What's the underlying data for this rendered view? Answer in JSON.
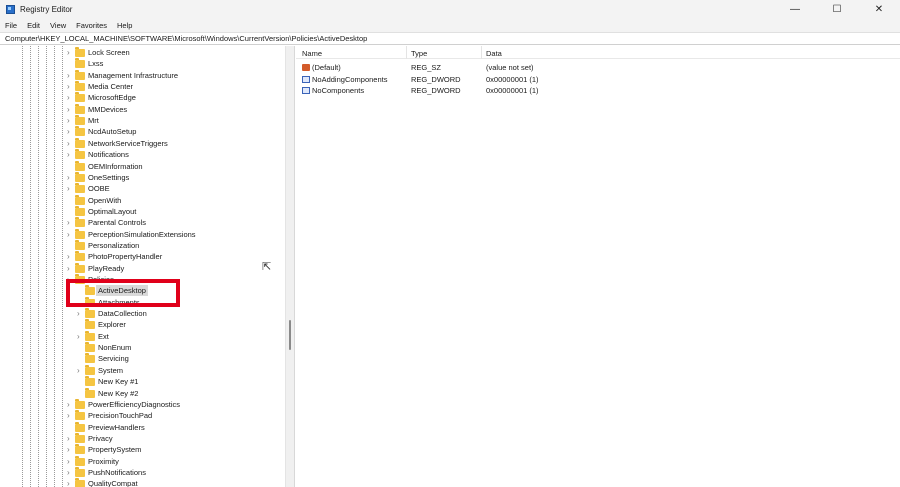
{
  "window": {
    "title": "Registry Editor",
    "minimize": "—",
    "maximize": "☐",
    "close": "✕"
  },
  "menu": [
    "File",
    "Edit",
    "View",
    "Favorites",
    "Help"
  ],
  "address": "Computer\\HKEY_LOCAL_MACHINE\\SOFTWARE\\Microsoft\\Windows\\CurrentVersion\\Policies\\ActiveDesktop",
  "tree": [
    {
      "label": "Lock Screen",
      "level": 0,
      "expander": true
    },
    {
      "label": "Lxss",
      "level": 0,
      "expander": false
    },
    {
      "label": "Management Infrastructure",
      "level": 0,
      "expander": true
    },
    {
      "label": "Media Center",
      "level": 0,
      "expander": true
    },
    {
      "label": "MicrosoftEdge",
      "level": 0,
      "expander": true
    },
    {
      "label": "MMDevices",
      "level": 0,
      "expander": true
    },
    {
      "label": "Mrt",
      "level": 0,
      "expander": true
    },
    {
      "label": "NcdAutoSetup",
      "level": 0,
      "expander": true
    },
    {
      "label": "NetworkServiceTriggers",
      "level": 0,
      "expander": true
    },
    {
      "label": "Notifications",
      "level": 0,
      "expander": true
    },
    {
      "label": "OEMInformation",
      "level": 0,
      "expander": false
    },
    {
      "label": "OneSettings",
      "level": 0,
      "expander": true
    },
    {
      "label": "OOBE",
      "level": 0,
      "expander": true
    },
    {
      "label": "OpenWith",
      "level": 0,
      "expander": false
    },
    {
      "label": "OptimalLayout",
      "level": 0,
      "expander": false
    },
    {
      "label": "Parental Controls",
      "level": 0,
      "expander": true
    },
    {
      "label": "PerceptionSimulationExtensions",
      "level": 0,
      "expander": true
    },
    {
      "label": "Personalization",
      "level": 0,
      "expander": false
    },
    {
      "label": "PhotoPropertyHandler",
      "level": 0,
      "expander": true
    },
    {
      "label": "PlayReady",
      "level": 0,
      "expander": true
    },
    {
      "label": "Policies",
      "level": 0,
      "expander": true
    },
    {
      "label": "ActiveDesktop",
      "level": 1,
      "expander": false,
      "selected": true
    },
    {
      "label": "Attachments",
      "level": 1,
      "expander": false
    },
    {
      "label": "DataCollection",
      "level": 1,
      "expander": true
    },
    {
      "label": "Explorer",
      "level": 1,
      "expander": false
    },
    {
      "label": "Ext",
      "level": 1,
      "expander": true
    },
    {
      "label": "NonEnum",
      "level": 1,
      "expander": false
    },
    {
      "label": "Servicing",
      "level": 1,
      "expander": false
    },
    {
      "label": "System",
      "level": 1,
      "expander": true
    },
    {
      "label": "New Key #1",
      "level": 1,
      "expander": false
    },
    {
      "label": "New Key #2",
      "level": 1,
      "expander": false
    },
    {
      "label": "PowerEfficiencyDiagnostics",
      "level": 0,
      "expander": true
    },
    {
      "label": "PrecisionTouchPad",
      "level": 0,
      "expander": true
    },
    {
      "label": "PreviewHandlers",
      "level": 0,
      "expander": false
    },
    {
      "label": "Privacy",
      "level": 0,
      "expander": true
    },
    {
      "label": "PropertySystem",
      "level": 0,
      "expander": true
    },
    {
      "label": "Proximity",
      "level": 0,
      "expander": true
    },
    {
      "label": "PushNotifications",
      "level": 0,
      "expander": true
    },
    {
      "label": "QualityCompat",
      "level": 0,
      "expander": true
    }
  ],
  "columns": {
    "name": "Name",
    "type": "Type",
    "data": "Data"
  },
  "values": [
    {
      "name": "(Default)",
      "type": "REG_SZ",
      "data": "(value not set)",
      "icon": "string-value-icon"
    },
    {
      "name": "NoAddingComponents",
      "type": "REG_DWORD",
      "data": "0x00000001 (1)",
      "icon": "binary-value-icon"
    },
    {
      "name": "NoComponents",
      "type": "REG_DWORD",
      "data": "0x00000001 (1)",
      "icon": "binary-value-icon"
    }
  ],
  "colors": {
    "highlight": "#e0001a"
  }
}
